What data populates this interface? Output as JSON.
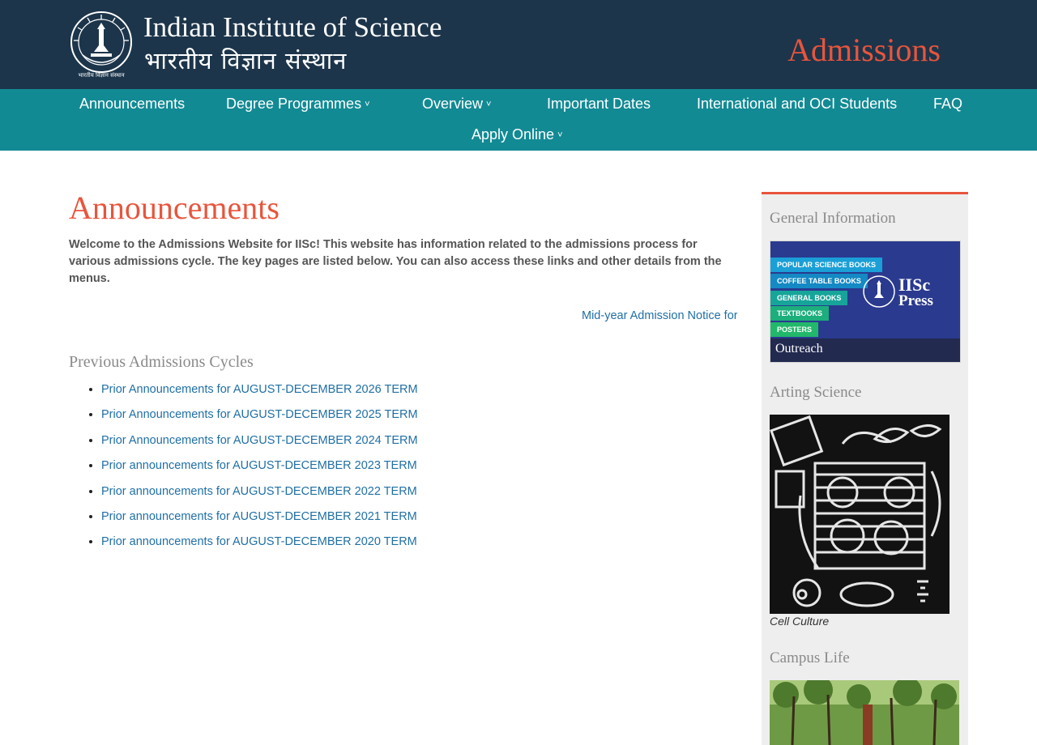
{
  "header": {
    "institute_en": "Indian Institute of Science",
    "institute_hi": "भारतीय विज्ञान संस्थान",
    "site_title": "Admissions",
    "seal_caption": "भारतीय विज्ञान संस्थान",
    "colors": {
      "bg": "#1c354b",
      "accent": "#e8553c"
    }
  },
  "nav": {
    "items": [
      {
        "label": "Announcements",
        "has_dropdown": false
      },
      {
        "label": "Degree Programmes",
        "has_dropdown": true
      },
      {
        "label": "Overview",
        "has_dropdown": true
      },
      {
        "label": "Important Dates",
        "has_dropdown": false
      },
      {
        "label": "International and OCI Students",
        "has_dropdown": false
      },
      {
        "label": "FAQ",
        "has_dropdown": false
      },
      {
        "label": "Apply Online",
        "has_dropdown": true
      }
    ],
    "caret": "˅",
    "colors": {
      "bg": "#128a94"
    }
  },
  "main": {
    "title": "Announcements",
    "intro": "Welcome to the Admissions Website for IISc! This website has information related to the admissions process for various admissions cycle. The key pages are listed below. You can also access these links and other details from the menus.",
    "ticker": "Mid-year Admission Notice for I",
    "previous_heading": "Previous Admissions Cycles",
    "previous_links": [
      "Prior Announcements for AUGUST-DECEMBER 2026 TERM",
      "Prior Announcements for AUGUST-DECEMBER 2025 TERM",
      "Prior Announcements for AUGUST-DECEMBER 2024 TERM",
      "Prior announcements for AUGUST-DECEMBER 2023 TERM",
      "Prior announcements for AUGUST-DECEMBER 2022 TERM",
      "Prior announcements for AUGUST-DECEMBER 2021 TERM",
      "Prior announcements for AUGUST-DECEMBER 2020 TERM"
    ]
  },
  "sidebar": {
    "general_heading": "General Information",
    "press": {
      "tags": [
        "POPULAR SCIENCE BOOKS",
        "COFFEE TABLE BOOKS",
        "GENERAL BOOKS",
        "TEXTBOOKS",
        "POSTERS"
      ],
      "title_line1": "IISc",
      "title_line2": "Press",
      "caption": "Outreach"
    },
    "arting_heading": "Arting Science",
    "art_caption": "Cell Culture",
    "campus_heading": "Campus Life"
  }
}
